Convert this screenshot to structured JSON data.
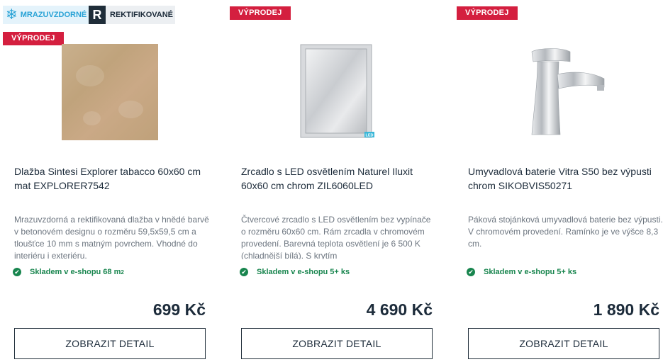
{
  "products": [
    {
      "sale_badge": "VÝPRODEJ",
      "tags": {
        "frost": "MRAZUVZDORNÉ",
        "rect_letter": "R",
        "rect": "REKTIFIKOVANÉ"
      },
      "title": "Dlažba Sintesi Explorer tabacco 60x60 cm mat EXPLORER7542",
      "description": "Mrazuvzdorná a rektifikovaná dlažba v hnědé barvě v betonovém designu o rozměru 59,5x59,5 cm a tloušťce 10 mm s matným povrchem. Vhodné do interiéru i exteriéru.",
      "stock": "Skladem v e-shopu 68 m",
      "stock_sup": "2",
      "price": "699 Kč",
      "button": "ZOBRAZIT DETAIL"
    },
    {
      "sale_badge": "VÝPRODEJ",
      "led_label": "LED",
      "title": "Zrcadlo s LED osvětlením Naturel Iluxit 60x60 cm chrom ZIL6060LED",
      "description": "Čtvercové zrcadlo s LED osvětlením bez vypínače o rozměru 60x60 cm. Rám zrcadla v chromovém provedení. Barevná teplota osvětlení je 6 500 K (chladnější bílá). S krytím",
      "stock": "Skladem v e-shopu 5+ ks",
      "price": "4 690 Kč",
      "button": "ZOBRAZIT DETAIL"
    },
    {
      "sale_badge": "VÝPRODEJ",
      "title": "Umyvadlová baterie Vitra S50 bez výpusti chrom SIKOBVIS50271",
      "description": "Páková stojánková umyvadlová baterie bez výpusti. V chromovém provedení. Ramínko je ve výšce 8,3 cm.",
      "stock": "Skladem v e-shopu 5+ ks",
      "price": "1 890 Kč",
      "button": "ZOBRAZIT DETAIL"
    }
  ],
  "colors": {
    "sale": "#d41f3f",
    "stock": "#18854e",
    "frost": "#2aa3d6"
  }
}
